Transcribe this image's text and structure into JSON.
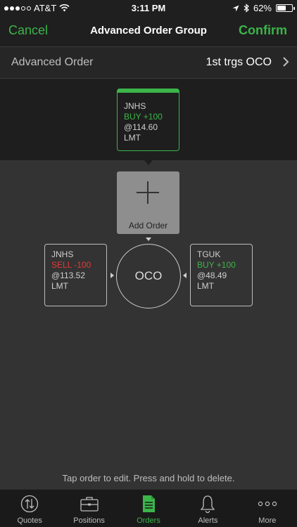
{
  "status_bar": {
    "carrier": "AT&T",
    "time": "3:11 PM",
    "battery": "62%",
    "battery_level": 0.62
  },
  "nav": {
    "cancel_label": "Cancel",
    "title": "Advanced Order Group",
    "confirm_label": "Confirm"
  },
  "advanced_order": {
    "label": "Advanced Order",
    "value": "1st trgs OCO"
  },
  "parent_order": {
    "symbol": "JNHS",
    "action": "BUY +100",
    "price": "@114.60",
    "type": "LMT"
  },
  "add_order": {
    "label": "Add Order"
  },
  "oco": {
    "label": "OCO"
  },
  "left_order": {
    "symbol": "JNHS",
    "action": "SELL -100",
    "price": "@113.52",
    "type": "LMT"
  },
  "right_order": {
    "symbol": "TGUK",
    "action": "BUY +100",
    "price": "@48.49",
    "type": "LMT"
  },
  "hint": "Tap order to edit. Press and hold to delete.",
  "tabs": [
    {
      "label": "Quotes",
      "icon": "quotes-icon"
    },
    {
      "label": "Positions",
      "icon": "briefcase-icon"
    },
    {
      "label": "Orders",
      "icon": "document-icon"
    },
    {
      "label": "Alerts",
      "icon": "bell-icon"
    },
    {
      "label": "More",
      "icon": "more-dots-icon"
    }
  ],
  "colors": {
    "accent_green": "#3cb44a",
    "sell_red": "#e53935",
    "background": "#333333"
  }
}
